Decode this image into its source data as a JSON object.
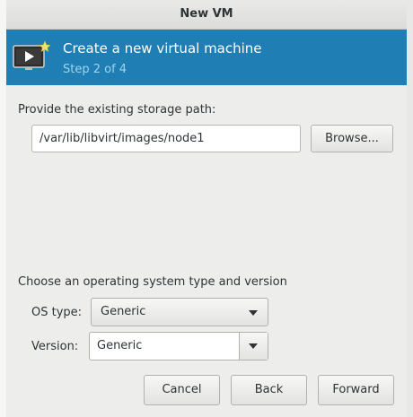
{
  "window": {
    "title": "New VM"
  },
  "banner": {
    "title": "Create a new virtual machine",
    "step": "Step 2 of 4"
  },
  "storage": {
    "label": "Provide the existing storage path:",
    "path_value": "/var/lib/libvirt/images/node1",
    "browse_label": "Browse..."
  },
  "os": {
    "section_label": "Choose an operating system type and version",
    "type_label": "OS type:",
    "type_value": "Generic",
    "version_label": "Version:",
    "version_value": "Generic"
  },
  "footer": {
    "cancel_label": "Cancel",
    "back_label": "Back",
    "forward_label": "Forward"
  },
  "colors": {
    "banner_bg": "#1f7fb4",
    "banner_step_text": "#9fd3ef",
    "dialog_bg": "#ededec"
  },
  "icons": {
    "banner_icon": "vm-display-new-icon",
    "dropdown_arrow": "chevron-down-icon"
  }
}
